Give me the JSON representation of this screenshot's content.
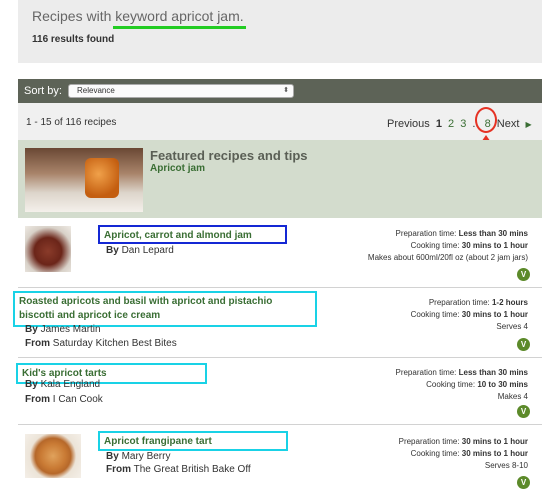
{
  "search": {
    "title_prefix": "Recipes with ",
    "keyword": "keyword apricot jam.",
    "results_found": "116 results found"
  },
  "sort": {
    "label": "Sort by:",
    "selected": "Relevance",
    "arrow": "⬍"
  },
  "paging": {
    "range": "1 - 15 of 116 recipes",
    "previous": "Previous",
    "pages": [
      "1",
      "2",
      "3"
    ],
    "ellipsis": "..",
    "last": "8",
    "next": "Next",
    "next_arrow": "▶"
  },
  "featured": {
    "title": "Featured recipes and tips",
    "subtitle": "Apricot jam"
  },
  "recipes": [
    {
      "title": "Apricot, carrot and almond jam",
      "by_label": "By",
      "author": "Dan Lepard",
      "prep_label": "Preparation time:",
      "prep": "Less than 30 mins",
      "cook_label": "Cooking time:",
      "cook": "30 mins to 1 hour",
      "yield": "Makes about 600ml/20fl oz (about 2 jam jars)",
      "badge": "V"
    },
    {
      "title_line1": "Roasted apricots and basil with apricot and pistachio",
      "title_line2": "biscotti and apricot ice cream",
      "by_label": "By",
      "author": "James Martin",
      "from_label": "From",
      "source": "Saturday Kitchen Best Bites",
      "prep_label": "Preparation time:",
      "prep": "1-2 hours",
      "cook_label": "Cooking time:",
      "cook": "30 mins to 1 hour",
      "yield": "Serves 4",
      "badge": "V"
    },
    {
      "title": "Kid's apricot tarts",
      "by_label": "By",
      "author": "Kala England",
      "from_label": "From",
      "source": "I Can Cook",
      "prep_label": "Preparation time:",
      "prep": "Less than 30 mins",
      "cook_label": "Cooking time:",
      "cook": "10 to 30 mins",
      "yield": "Makes 4",
      "badge": "V"
    },
    {
      "title": "Apricot frangipane tart",
      "by_label": "By",
      "author": "Mary Berry",
      "from_label": "From",
      "source": "The Great British Bake Off",
      "prep_label": "Preparation time:",
      "prep": "30 mins to 1 hour",
      "cook_label": "Cooking time:",
      "cook": "30 mins to 1 hour",
      "yield": "Serves 8-10",
      "badge": "V"
    }
  ],
  "annotation_colors": {
    "keyword_underline": "#22cc22",
    "page_circle": "#e53224",
    "blue_box": "#1428d4",
    "cyan_box": "#19d2e6"
  }
}
